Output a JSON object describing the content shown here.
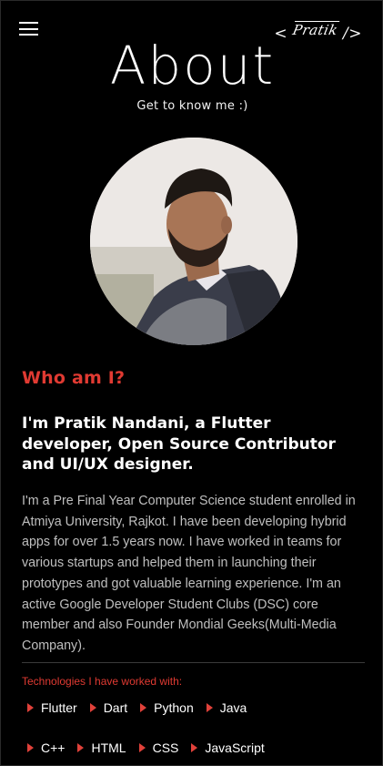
{
  "header": {
    "menu_icon": "hamburger-menu-icon",
    "logo": {
      "open": "< ",
      "signature": "Pratik",
      "close": " />"
    }
  },
  "hero": {
    "title": "About",
    "subtitle": "Get to know me :)"
  },
  "about": {
    "heading": "Who am I?",
    "intro": "I'm Pratik Nandani, a Flutter developer, Open Source Contributor and UI/UX designer.",
    "bio": "I'm a Pre Final Year Computer Science student enrolled in Atmiya University, Rajkot. I have been developing hybrid apps for over 1.5 years now. I have worked in teams for various startups and helped them in launching their prototypes and got valuable learning experience. I'm an active Google Developer Student Clubs (DSC) core member and also Founder Mondial Geeks(Multi-Media Company)."
  },
  "technologies": {
    "label": "Technologies I have worked with:",
    "row1": [
      "Flutter",
      "Dart",
      "Python",
      "Java"
    ],
    "row2": [
      "C++",
      "HTML",
      "CSS",
      "JavaScript"
    ],
    "bullet_icon": "triangle-bullet-icon"
  },
  "colors": {
    "background": "#000000",
    "accent": "#e03a32",
    "text": "#ffffff",
    "muted_text": "#bfbfbf"
  }
}
